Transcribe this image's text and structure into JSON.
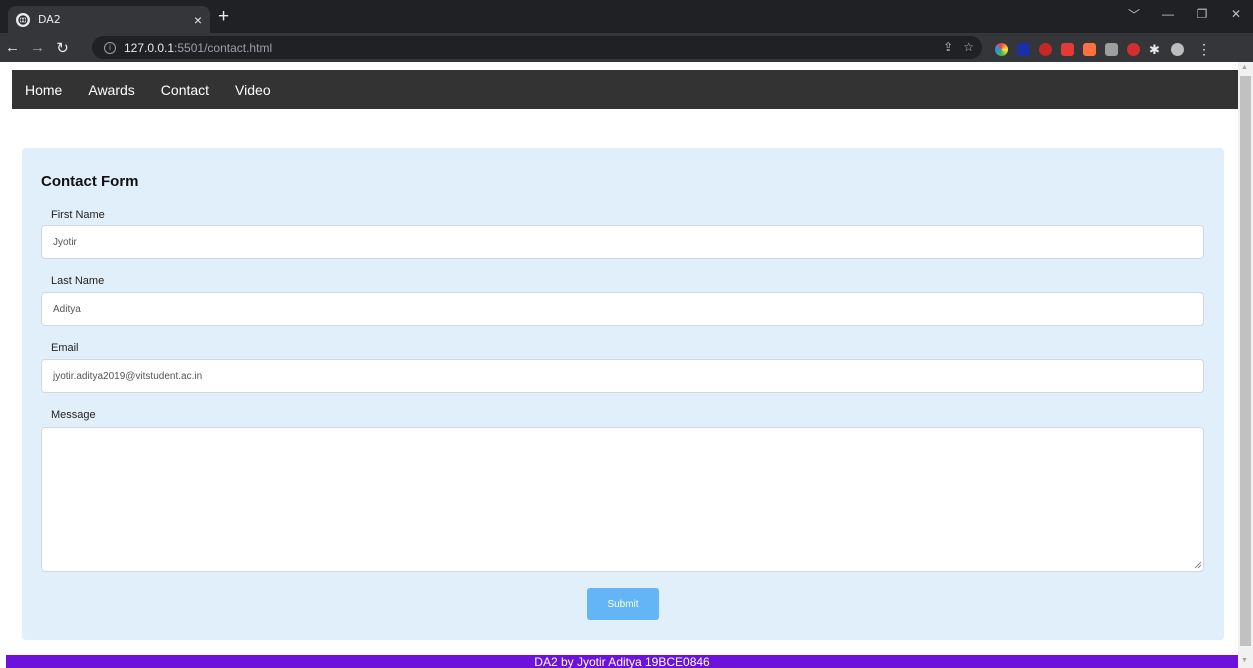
{
  "browser": {
    "tab_title": "DA2",
    "tab_close": "×",
    "new_tab": "+",
    "url_host": "127.0.0.1",
    "url_rest": ":5501/contact.html",
    "window_controls": [
      "﹀",
      "—",
      "❐",
      "✕"
    ]
  },
  "nav": {
    "items": [
      "Home",
      "Awards",
      "Contact",
      "Video"
    ]
  },
  "form": {
    "title": "Contact Form",
    "first_name": {
      "label": "First Name",
      "value": "Jyotir"
    },
    "last_name": {
      "label": "Last Name",
      "value": "Aditya"
    },
    "email": {
      "label": "Email",
      "value": "jyotir.aditya2019@vitstudent.ac.in"
    },
    "message": {
      "label": "Message",
      "value": ""
    },
    "submit_label": "Submit"
  },
  "footer": {
    "text": "DA2 by Jyotir Aditya 19BCE0846"
  },
  "colors": {
    "nav_bg": "#333333",
    "card_bg": "#e1effb",
    "submit_bg": "#64b5f6",
    "footer_bg": "#6d12db"
  }
}
